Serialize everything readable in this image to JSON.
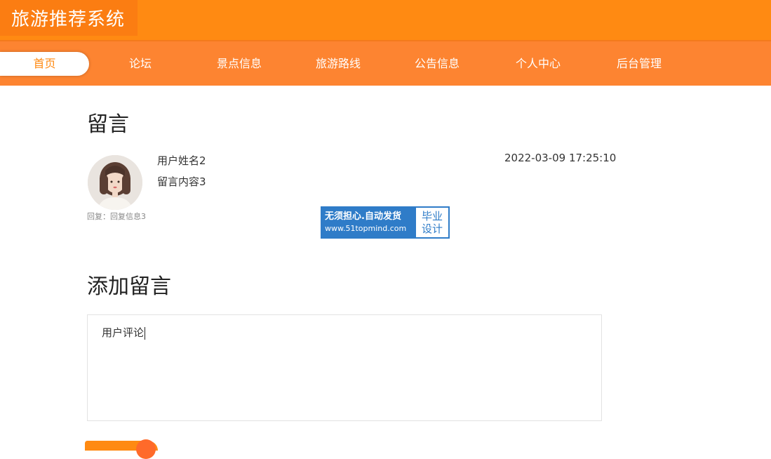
{
  "header": {
    "site_title": "旅游推荐系统"
  },
  "nav": {
    "items": [
      {
        "label": "首页",
        "active": true
      },
      {
        "label": "论坛"
      },
      {
        "label": "景点信息"
      },
      {
        "label": "旅游路线"
      },
      {
        "label": "公告信息"
      },
      {
        "label": "个人中心"
      },
      {
        "label": "后台管理"
      }
    ]
  },
  "messages": {
    "section_title": "留言",
    "items": [
      {
        "user_name": "用户姓名2",
        "content": "留言内容3",
        "time": "2022-03-09 17:25:10",
        "reply": "回复：回复信息3"
      }
    ]
  },
  "watermark": {
    "line1": "无须担心.自动发货",
    "line2": "www.51topmind.com",
    "badge_line1": "毕业",
    "badge_line2": "设计"
  },
  "add_message": {
    "section_title": "添加留言",
    "textarea_value": "用户评论"
  },
  "colors": {
    "header_bg": "#ff8a12",
    "nav_bg": "#fd8431",
    "active_nav_text": "#ff8a12"
  }
}
